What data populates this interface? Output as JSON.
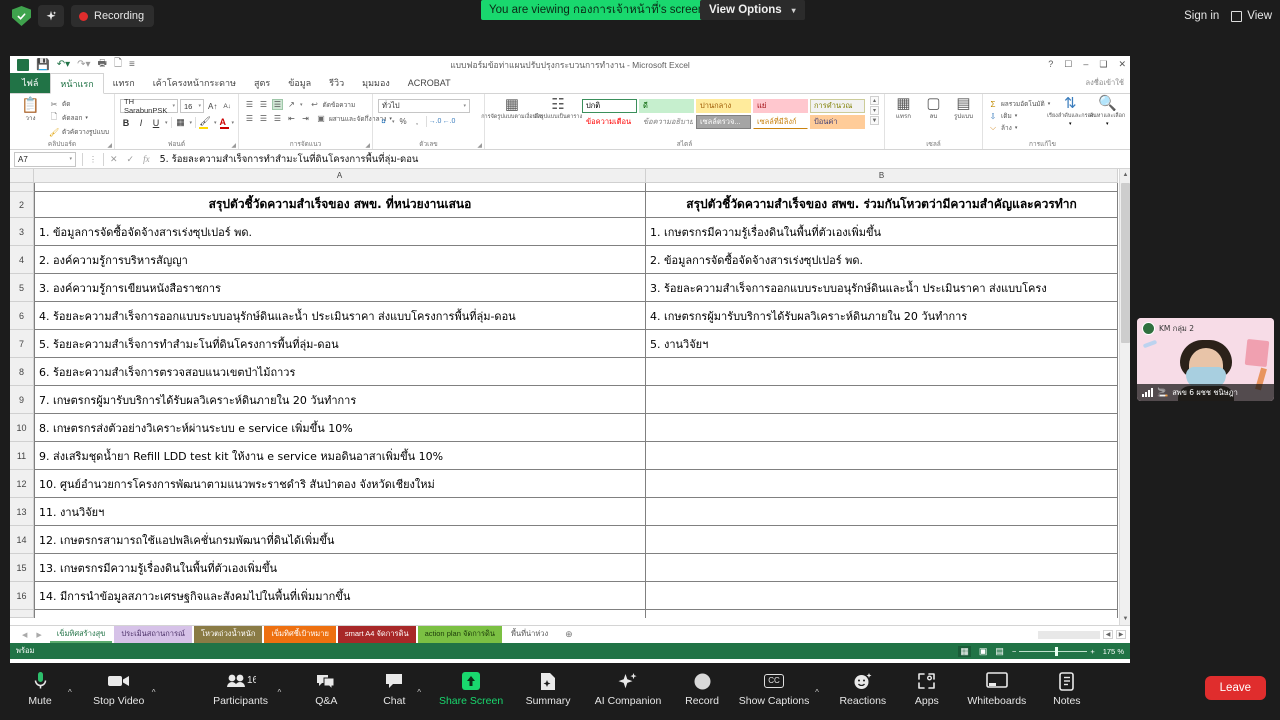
{
  "zoom_top": {
    "security_icon": "shield-check-icon",
    "ai_icon": "sparkle-icon",
    "recording_label": "Recording",
    "viewing_banner": "You are viewing กองการเจ้าหน้าที่'s screen",
    "view_options_label": "View Options",
    "sign_in_label": "Sign in",
    "view_label": "View"
  },
  "excel": {
    "title": "แบบฟอร์มข้อท่าแผนปรับปรุงกระบวนการทำงาน - Microsoft Excel",
    "quick_access": [
      "save-icon",
      "undo-icon",
      "redo-icon",
      "print-preview-icon",
      "open-icon",
      "customize-icon"
    ],
    "window_buttons": [
      "?",
      "ribbon-display-icon",
      "minimize-icon",
      "restore-icon",
      "close-icon"
    ],
    "tabs": [
      {
        "label": "ไฟล์",
        "type": "file"
      },
      {
        "label": "หน้าแรก",
        "type": "active"
      },
      {
        "label": "แทรก",
        "type": "normal"
      },
      {
        "label": "เค้าโครงหน้ากระดาษ",
        "type": "normal"
      },
      {
        "label": "สูตร",
        "type": "normal"
      },
      {
        "label": "ข้อมูล",
        "type": "normal"
      },
      {
        "label": "รีวิว",
        "type": "normal"
      },
      {
        "label": "มุมมอง",
        "type": "normal"
      },
      {
        "label": "ACROBAT",
        "type": "normal"
      }
    ],
    "user_note": "ลงชื่อเข้าใช้",
    "ribbon": {
      "clipboard": {
        "group_label": "คลิปบอร์ด",
        "paste_label": "วาง",
        "items": [
          {
            "icon": "scissors-icon",
            "label": "ตัด"
          },
          {
            "icon": "copy-icon",
            "label": "คัดลอก"
          },
          {
            "icon": "format-painter-icon",
            "label": "ตัวคัดวางรูปแบบ"
          }
        ]
      },
      "font": {
        "group_label": "ฟอนต์",
        "font_name": "TH SarabunPSK",
        "font_size": "16",
        "grow_label": "A",
        "shrink_label": "A",
        "bold": "B",
        "italic": "I",
        "underline": "U",
        "border_icon": "borders-icon",
        "fill_icon": "fill-color-icon",
        "fontcolor_icon": "font-color-icon"
      },
      "alignment": {
        "group_label": "การจัดแนว",
        "wrap_text_label": "ตัดข้อความ",
        "merge_label": "ผสานและจัดกึ่งกลาง",
        "orientation_icon": "text-orientation-icon"
      },
      "number": {
        "group_label": "ตัวเลข",
        "format_value": "ทั่วไป",
        "currency_icon": "currency-icon",
        "percent_label": "%",
        "comma_label": ",",
        "inc_dec_icon": "increase-decimal-icon",
        "dec_dec_icon": "decrease-decimal-icon"
      },
      "styles": {
        "group_label": "สไตล์",
        "cond_format_label": "การจัดรูปแบบตามเงื่อนไข",
        "table_format_label": "จัดรูปแบบเป็นตาราง",
        "cells": [
          {
            "label": "ปกติ",
            "bg": "#ffffff",
            "fg": "#000000",
            "border": "#3a8f5b"
          },
          {
            "label": "ดี",
            "bg": "#c6efce",
            "fg": "#006100",
            "border": "#c6efce"
          },
          {
            "label": "ปานกลาง",
            "bg": "#ffeb9c",
            "fg": "#9c5700",
            "border": "#ffeb9c"
          },
          {
            "label": "แย่",
            "bg": "#ffc7ce",
            "fg": "#9c0006",
            "border": "#ffc7ce"
          },
          {
            "label": "การคำนวณ",
            "bg": "#f2f2f2",
            "fg": "#7f7f00",
            "border": "#cccc99"
          },
          {
            "label": "ข้อความเตือน",
            "bg": "#ffffff",
            "fg": "#ff0000",
            "border": "#ffffff"
          },
          {
            "label": "ข้อความอธิบาย",
            "bg": "#ffffff",
            "fg": "#7f7f7f",
            "border": "#ffffff"
          },
          {
            "label": "เซลล์ตรวจ...",
            "bg": "#a5a5a5",
            "fg": "#ffffff",
            "border": "#7f7f7f"
          },
          {
            "label": "เซลล์ที่มีลิงก์",
            "bg": "#ffffff",
            "fg": "#c9820f",
            "border": "#ffffff"
          },
          {
            "label": "ป้อนค่า",
            "bg": "#ffcc99",
            "fg": "#3f3f76",
            "border": "#ffcc99"
          }
        ]
      },
      "cells": {
        "group_label": "เซลล์",
        "items": [
          {
            "icon": "insert-cells-icon",
            "label": "แทรก"
          },
          {
            "icon": "delete-cells-icon",
            "label": "ลบ"
          },
          {
            "icon": "format-cells-icon",
            "label": "รูปแบบ"
          }
        ]
      },
      "editing": {
        "group_label": "การแก้ไข",
        "items": [
          {
            "icon": "autosum-icon",
            "label": "ผลรวมอัตโนมัติ"
          },
          {
            "icon": "fill-icon",
            "label": "เติม"
          },
          {
            "icon": "clear-icon",
            "label": "ล้าง"
          },
          {
            "icon": "sort-filter-icon",
            "label": "เรียงลำดับและกรอง"
          },
          {
            "icon": "find-select-icon",
            "label": "ค้นหาและเลือก"
          }
        ]
      }
    },
    "formula_bar": {
      "name_box": "A7",
      "cancel_icon": "cancel-icon",
      "confirm_icon": "confirm-icon",
      "function_icon": "fx-icon",
      "value": "5. ร้อยละความสำเร็จการทำสำมะโนที่ดินโครงการพื้นที่ลุ่ม-ดอน"
    },
    "grid": {
      "columns": [
        "A",
        "B"
      ],
      "rows": [
        {
          "num": "2",
          "a": "สรุปตัวชี้วัดความสำเร็จของ สพข. ที่หน่วยงานเสนอ",
          "b": "สรุปตัวชี้วัดความสำเร็จของ สพข. ร่วมกันโหวตว่ามีความสำคัญและควรทำก",
          "header": true
        },
        {
          "num": "3",
          "a": "1. ข้อมูลการจัดซื้อจัดจ้างสารเร่งซุปเปอร์ พด.",
          "b": "1. เกษตรกรมีความรู้เรื่องดินในพื้นที่ตัวเองเพิ่มขึ้น"
        },
        {
          "num": "4",
          "a": "2. องค์ความรู้การบริหารสัญญา",
          "b": "2. ข้อมูลการจัดซื้อจัดจ้างสารเร่งซุปเปอร์ พด."
        },
        {
          "num": "5",
          "a": "3. องค์ความรู้การเขียนหนังสือราชการ",
          "b": "3. ร้อยละความสำเร็จการออกแบบระบบอนุรักษ์ดินและน้ำ ประเมินราคา ส่งแบบโครง"
        },
        {
          "num": "6",
          "a": "4. ร้อยละความสำเร็จการออกแบบระบบอนุรักษ์ดินและน้ำ ประเมินราคา ส่งแบบโครงการพื้นที่ลุ่ม-ดอน",
          "b": "4. เกษตรกรผู้มารับบริการได้รับผลวิเคราะห์ดินภายใน 20 วันทำการ"
        },
        {
          "num": "7",
          "a": "5. ร้อยละความสำเร็จการทำสำมะโนที่ดินโครงการพื้นที่ลุ่ม-ดอน",
          "b": "5. งานวิจัยฯ"
        },
        {
          "num": "8",
          "a": "6. ร้อยละความสำเร็จการตรวจสอบแนวเขตป่าไม้ถาวร",
          "b": ""
        },
        {
          "num": "9",
          "a": "7. เกษตรกรผู้มารับบริการได้รับผลวิเคราะห์ดินภายใน 20 วันทำการ",
          "b": ""
        },
        {
          "num": "10",
          "a": "8. เกษตรกรส่งตัวอย่างวิเคราะห์ผ่านระบบ e service เพิ่มขึ้น 10%",
          "b": ""
        },
        {
          "num": "11",
          "a": "9. ส่งเสริมชุดน้ำยา Refill LDD test kit ให้งาน e service หมอดินอาสาเพิ่มขึ้น 10%",
          "b": ""
        },
        {
          "num": "12",
          "a": "10. ศูนย์อำนวยการโครงการพัฒนาตามแนวพระราชดำริ สันป่าตอง จังหวัดเชียงใหม่",
          "b": ""
        },
        {
          "num": "13",
          "a": "11. งานวิจัยฯ",
          "b": ""
        },
        {
          "num": "14",
          "a": "12. เกษตรกรสามารถใช้แอปพลิเคชั่นกรมพัฒนาที่ดินได้เพิ่มขึ้น",
          "b": ""
        },
        {
          "num": "15",
          "a": "13. เกษตรกรมีความรู้เรื่องดินในพื้นที่ตัวเองเพิ่มขึ้น",
          "b": ""
        },
        {
          "num": "16",
          "a": "14. มีการนำข้อมูลสภาวะเศรษฐกิจและสังคมไปในพื้นที่เพิ่มมากขึ้น",
          "b": ""
        }
      ]
    },
    "sheet_tabs": [
      {
        "label": "เข็มทิศสร้างสุข",
        "bg": "#ffffff",
        "fg": "#217346",
        "accent": "#5aab6e",
        "active": true
      },
      {
        "label": "ประเมินสถานการณ์",
        "bg": "#d6c2e8",
        "fg": "#4a2f66",
        "accent": "#a982cc"
      },
      {
        "label": "โหวตถ่วงน้ำหนัก",
        "bg": "#8a7b45",
        "fg": "#ffffff",
        "accent": "#6e6236"
      },
      {
        "label": "เข็มทิศชี้เป้าหมาย",
        "bg": "#ee7010",
        "fg": "#ffffff",
        "accent": "#c85a0a"
      },
      {
        "label": "smart A4 จัดการดิน",
        "bg": "#a82828",
        "fg": "#ffffff",
        "accent": "#8c1f1f"
      },
      {
        "label": "action plan จัดการดิน",
        "bg": "#7bc043",
        "fg": "#1d3d0a",
        "accent": "#5f9c32"
      },
      {
        "label": "พื้นที่น่าห่วง",
        "bg": "#ffffff",
        "fg": "#555555",
        "accent": "#ffffff"
      }
    ],
    "add_sheet_icon": "plus-circle-icon",
    "status": {
      "mode": "พร้อม",
      "view_icons": [
        "normal-view-icon",
        "page-layout-icon",
        "page-break-icon"
      ],
      "zoom_level": "175 %",
      "zoom_out": "−",
      "zoom_in": "+"
    }
  },
  "video_thumb": {
    "name_tag": "KM กลุ่ม 2",
    "bottom_label": "สพข 6 ผชช ชนิษฎา",
    "signal_icon": "signal-bars-icon",
    "mic_icon": "mic-off-icon"
  },
  "zoom_bottom": {
    "items": [
      {
        "label": "Mute",
        "icon": "microphone-icon",
        "caret": true,
        "green": false
      },
      {
        "label": "Stop Video",
        "icon": "video-camera-icon",
        "caret": true,
        "green": false
      },
      {
        "label": "Participants",
        "icon": "participants-icon",
        "caret": true,
        "green": false,
        "count": "16"
      },
      {
        "label": "Q&A",
        "icon": "qa-icon",
        "caret": false,
        "green": false
      },
      {
        "label": "Chat",
        "icon": "chat-icon",
        "caret": true,
        "green": false
      },
      {
        "label": "Share Screen",
        "icon": "share-screen-icon",
        "caret": false,
        "green": true
      },
      {
        "label": "Summary",
        "icon": "summary-icon",
        "caret": false,
        "green": false
      },
      {
        "label": "AI Companion",
        "icon": "sparkle-icon",
        "caret": false,
        "green": false
      },
      {
        "label": "Record",
        "icon": "record-icon",
        "caret": false,
        "green": false
      },
      {
        "label": "Show Captions",
        "icon": "cc-icon",
        "caret": true,
        "green": false
      },
      {
        "label": "Reactions",
        "icon": "reactions-icon",
        "caret": false,
        "green": false
      },
      {
        "label": "Apps",
        "icon": "apps-icon",
        "caret": false,
        "green": false
      },
      {
        "label": "Whiteboards",
        "icon": "whiteboard-icon",
        "caret": false,
        "green": false
      },
      {
        "label": "Notes",
        "icon": "notes-icon",
        "caret": false,
        "green": false
      }
    ],
    "leave_label": "Leave"
  },
  "colors": {
    "zoom_green": "#19d86e",
    "leave_red": "#e02d2d",
    "excel_green": "#217346"
  }
}
